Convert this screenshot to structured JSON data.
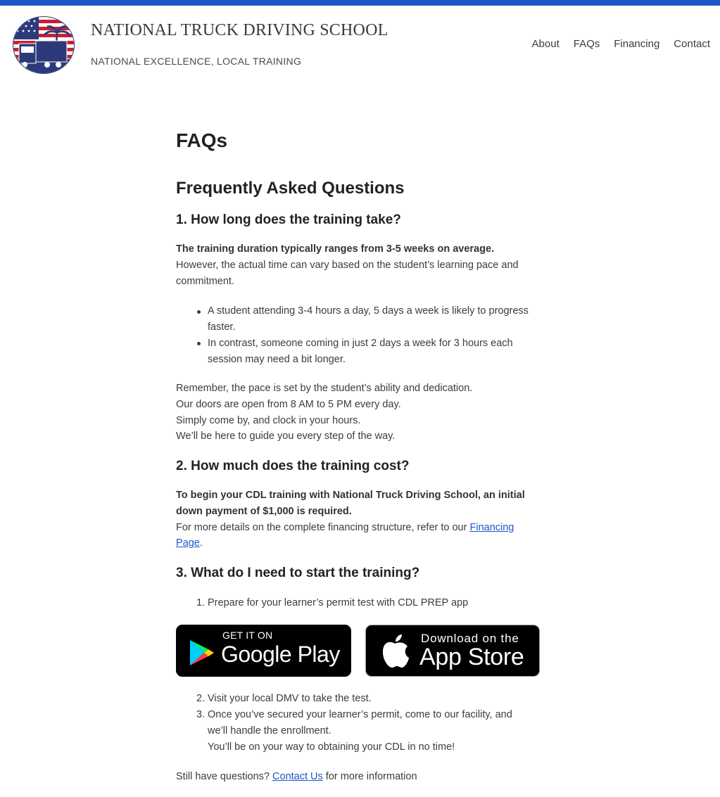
{
  "header": {
    "site_title": "NATIONAL TRUCK DRIVING SCHOOL",
    "tagline": "NATIONAL EXCELLENCE, LOCAL TRAINING",
    "nav": [
      "About",
      "FAQs",
      "Financing",
      "Contact"
    ]
  },
  "page": {
    "title": "FAQs",
    "heading": "Frequently Asked Questions"
  },
  "faq1": {
    "question": "1. How long does the training take?",
    "bold": "The training duration typically ranges from 3-5 weeks on average.",
    "text": "However, the actual time can vary based on the student’s learning pace and commitment.",
    "bullets": [
      "A student attending 3-4 hours a day, 5 days a week is likely to progress faster.",
      "In contrast, someone coming in just 2 days a week for 3 hours each session may need a bit longer."
    ],
    "closing": [
      "Remember, the pace is set by the student’s ability and dedication.",
      "Our doors are open from 8 AM to 5 PM every day.",
      "Simply come by, and clock in your hours.",
      "We’ll be here to guide you every step of the way."
    ]
  },
  "faq2": {
    "question": "2. How much does the training cost?",
    "bold": "To begin your CDL training with National Truck Driving School, an initial down payment of $1,000 is required.",
    "text_before": "For more details on the complete financing structure, refer to our ",
    "link": "Financing Page",
    "text_after": "."
  },
  "faq3": {
    "question": "3. What do I need to start the training?",
    "steps": [
      {
        "num": "1.",
        "text": "Prepare for your learner’s permit test with CDL PREP app"
      },
      {
        "num": "2.",
        "text": "Visit your local DMV to take the test."
      },
      {
        "num": "3.",
        "text": "Once you’ve secured your learner’s permit, come to our facility, and we’ll handle the enrollment."
      }
    ],
    "step3_extra": "You’ll be on your way to obtaining your CDL in no time!"
  },
  "badges": {
    "google_small": "GET IT ON",
    "google_big": "Google Play",
    "apple_small": "Download on the",
    "apple_big": "App Store"
  },
  "footer": {
    "before": "Still have questions? ",
    "link": "Contact Us",
    "after": " for more information"
  },
  "colors": {
    "accent": "#1e56c9",
    "navy": "#2d3a7a",
    "red": "#c8202f"
  }
}
